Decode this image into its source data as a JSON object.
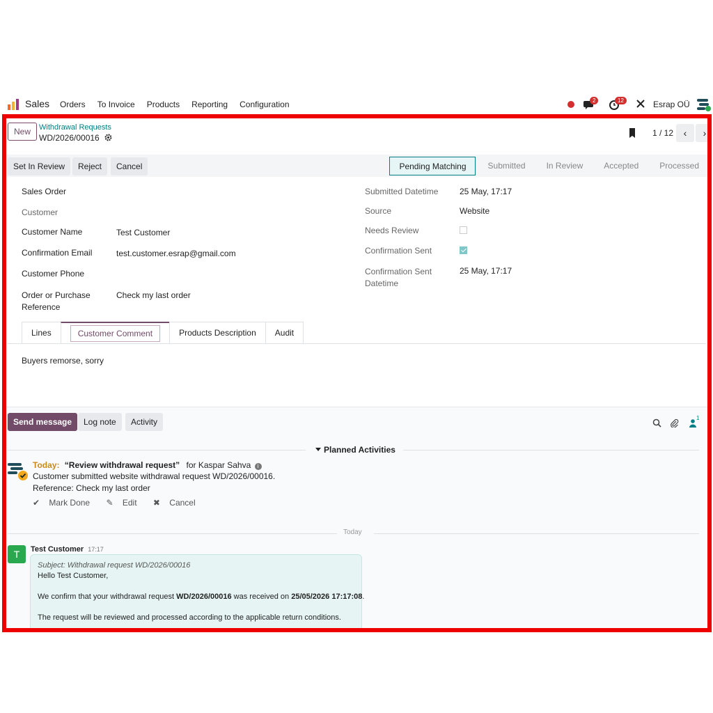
{
  "navbar": {
    "app_name": "Sales",
    "menu": [
      "Orders",
      "To Invoice",
      "Products",
      "Reporting",
      "Configuration"
    ],
    "messages_badge": "2",
    "activities_badge": "12",
    "company": "Esrap OÜ"
  },
  "control_panel": {
    "new_label": "New",
    "breadcrumb_parent": "Withdrawal Requests",
    "record_name": "WD/2026/00016",
    "pager": "1 / 12"
  },
  "actions": {
    "set_in_review": "Set In Review",
    "reject": "Reject",
    "cancel": "Cancel"
  },
  "stages": [
    "Pending Matching",
    "Submitted",
    "In Review",
    "Accepted",
    "Processed"
  ],
  "active_stage": "Pending Matching",
  "form": {
    "left": [
      {
        "label": "Sales Order",
        "value": ""
      },
      {
        "label": "Customer",
        "value": ""
      },
      {
        "label": "Customer Name",
        "value": "Test Customer"
      },
      {
        "label": "Confirmation Email",
        "value": "test.customer.esrap@gmail.com"
      },
      {
        "label": "Customer Phone",
        "value": ""
      },
      {
        "label": "Order or Purchase Reference",
        "value": "Check my last order"
      }
    ],
    "right": [
      {
        "label": "Submitted Datetime",
        "value": "25 May, 17:17"
      },
      {
        "label": "Source",
        "value": "Website"
      },
      {
        "label": "Needs Review",
        "checked": false
      },
      {
        "label": "Confirmation Sent",
        "checked": true
      },
      {
        "label": "Confirmation Sent Datetime",
        "value": "25 May, 17:17"
      }
    ]
  },
  "tabs": [
    "Lines",
    "Customer Comment",
    "Products Description",
    "Audit"
  ],
  "active_tab": "Customer Comment",
  "tab_content": "Buyers remorse, sorry",
  "chatter": {
    "send_message": "Send message",
    "log_note": "Log note",
    "activity": "Activity",
    "followers": "1",
    "planned_title": "Planned Activities",
    "activity_item": {
      "due": "Today:",
      "summary": "“Review withdrawal request”",
      "for": "for Kaspar Sahva",
      "note_line1": "Customer submitted website withdrawal request WD/2026/00016.",
      "note_line2": "Reference: Check my last order",
      "mark_done": "Mark Done",
      "edit": "Edit",
      "cancel": "Cancel"
    },
    "separator": "Today",
    "message": {
      "avatar_letter": "T",
      "author": "Test Customer",
      "time": "17:17",
      "subject": "Subject: Withdrawal request WD/2026/00016",
      "greeting": "Hello Test Customer,",
      "line_prefix": "We confirm that your withdrawal request ",
      "line_ref": "WD/2026/00016",
      "line_mid": " was received on ",
      "line_date": "25/05/2026 17:17:08",
      "line_end": ".",
      "line2": "The request will be reviewed and processed according to the applicable return conditions."
    }
  },
  "colors": {
    "brand": "#714b67",
    "teal": "#017e84",
    "frame": "#ee0000",
    "badge": "#d32f2f"
  }
}
